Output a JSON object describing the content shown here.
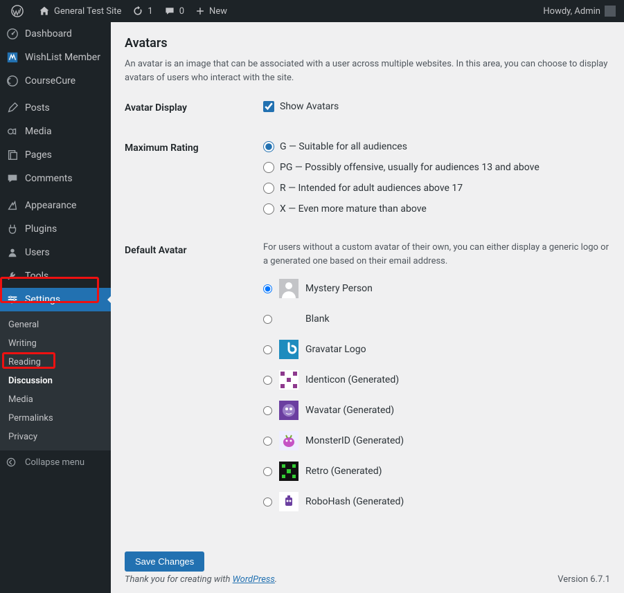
{
  "adminbar": {
    "site_name": "General Test Site",
    "updates_count": "1",
    "comments_count": "0",
    "new_label": "New",
    "howdy": "Howdy, Admin"
  },
  "sidebar": {
    "items": [
      {
        "icon": "dashboard",
        "label": "Dashboard"
      },
      {
        "icon": "wishlist",
        "label": "WishList Member"
      },
      {
        "icon": "course",
        "label": "CourseCure"
      },
      {
        "sep": true
      },
      {
        "icon": "posts",
        "label": "Posts"
      },
      {
        "icon": "media",
        "label": "Media"
      },
      {
        "icon": "pages",
        "label": "Pages"
      },
      {
        "icon": "comments",
        "label": "Comments"
      },
      {
        "sep": true
      },
      {
        "icon": "appearance",
        "label": "Appearance"
      },
      {
        "icon": "plugins",
        "label": "Plugins"
      },
      {
        "icon": "users",
        "label": "Users"
      },
      {
        "icon": "tools",
        "label": "Tools"
      },
      {
        "icon": "settings",
        "label": "Settings",
        "current": true
      }
    ],
    "submenu": [
      {
        "label": "General"
      },
      {
        "label": "Writing"
      },
      {
        "label": "Reading"
      },
      {
        "label": "Discussion",
        "active": true
      },
      {
        "label": "Media"
      },
      {
        "label": "Permalinks"
      },
      {
        "label": "Privacy"
      }
    ],
    "collapse": "Collapse menu"
  },
  "page": {
    "heading": "Avatars",
    "description": "An avatar is an image that can be associated with a user across multiple websites. In this area, you can choose to display avatars of users who interact with the site.",
    "avatar_display": {
      "label": "Avatar Display",
      "checkbox": "Show Avatars",
      "checked": true
    },
    "max_rating": {
      "label": "Maximum Rating",
      "options": [
        {
          "value": "G",
          "label": "G — Suitable for all audiences",
          "selected": true
        },
        {
          "value": "PG",
          "label": "PG — Possibly offensive, usually for audiences 13 and above"
        },
        {
          "value": "R",
          "label": "R — Intended for adult audiences above 17"
        },
        {
          "value": "X",
          "label": "X — Even more mature than above"
        }
      ]
    },
    "default_avatar": {
      "label": "Default Avatar",
      "intro": "For users without a custom avatar of their own, you can either display a generic logo or a generated one based on their email address.",
      "options": [
        {
          "value": "mystery",
          "label": "Mystery Person",
          "selected": true,
          "thumb": "mystery"
        },
        {
          "value": "blank",
          "label": "Blank",
          "thumb": "blank"
        },
        {
          "value": "gravatar",
          "label": "Gravatar Logo",
          "thumb": "gravatar"
        },
        {
          "value": "identicon",
          "label": "Identicon (Generated)",
          "thumb": "identicon"
        },
        {
          "value": "wavatar",
          "label": "Wavatar (Generated)",
          "thumb": "wavatar"
        },
        {
          "value": "monsterid",
          "label": "MonsterID (Generated)",
          "thumb": "monsterid"
        },
        {
          "value": "retro",
          "label": "Retro (Generated)",
          "thumb": "retro"
        },
        {
          "value": "robohash",
          "label": "RoboHash (Generated)",
          "thumb": "robohash"
        }
      ]
    },
    "save": "Save Changes"
  },
  "footer": {
    "thanks_prefix": "Thank you for creating with ",
    "link": "WordPress",
    "suffix": ".",
    "version": "Version 6.7.1"
  }
}
